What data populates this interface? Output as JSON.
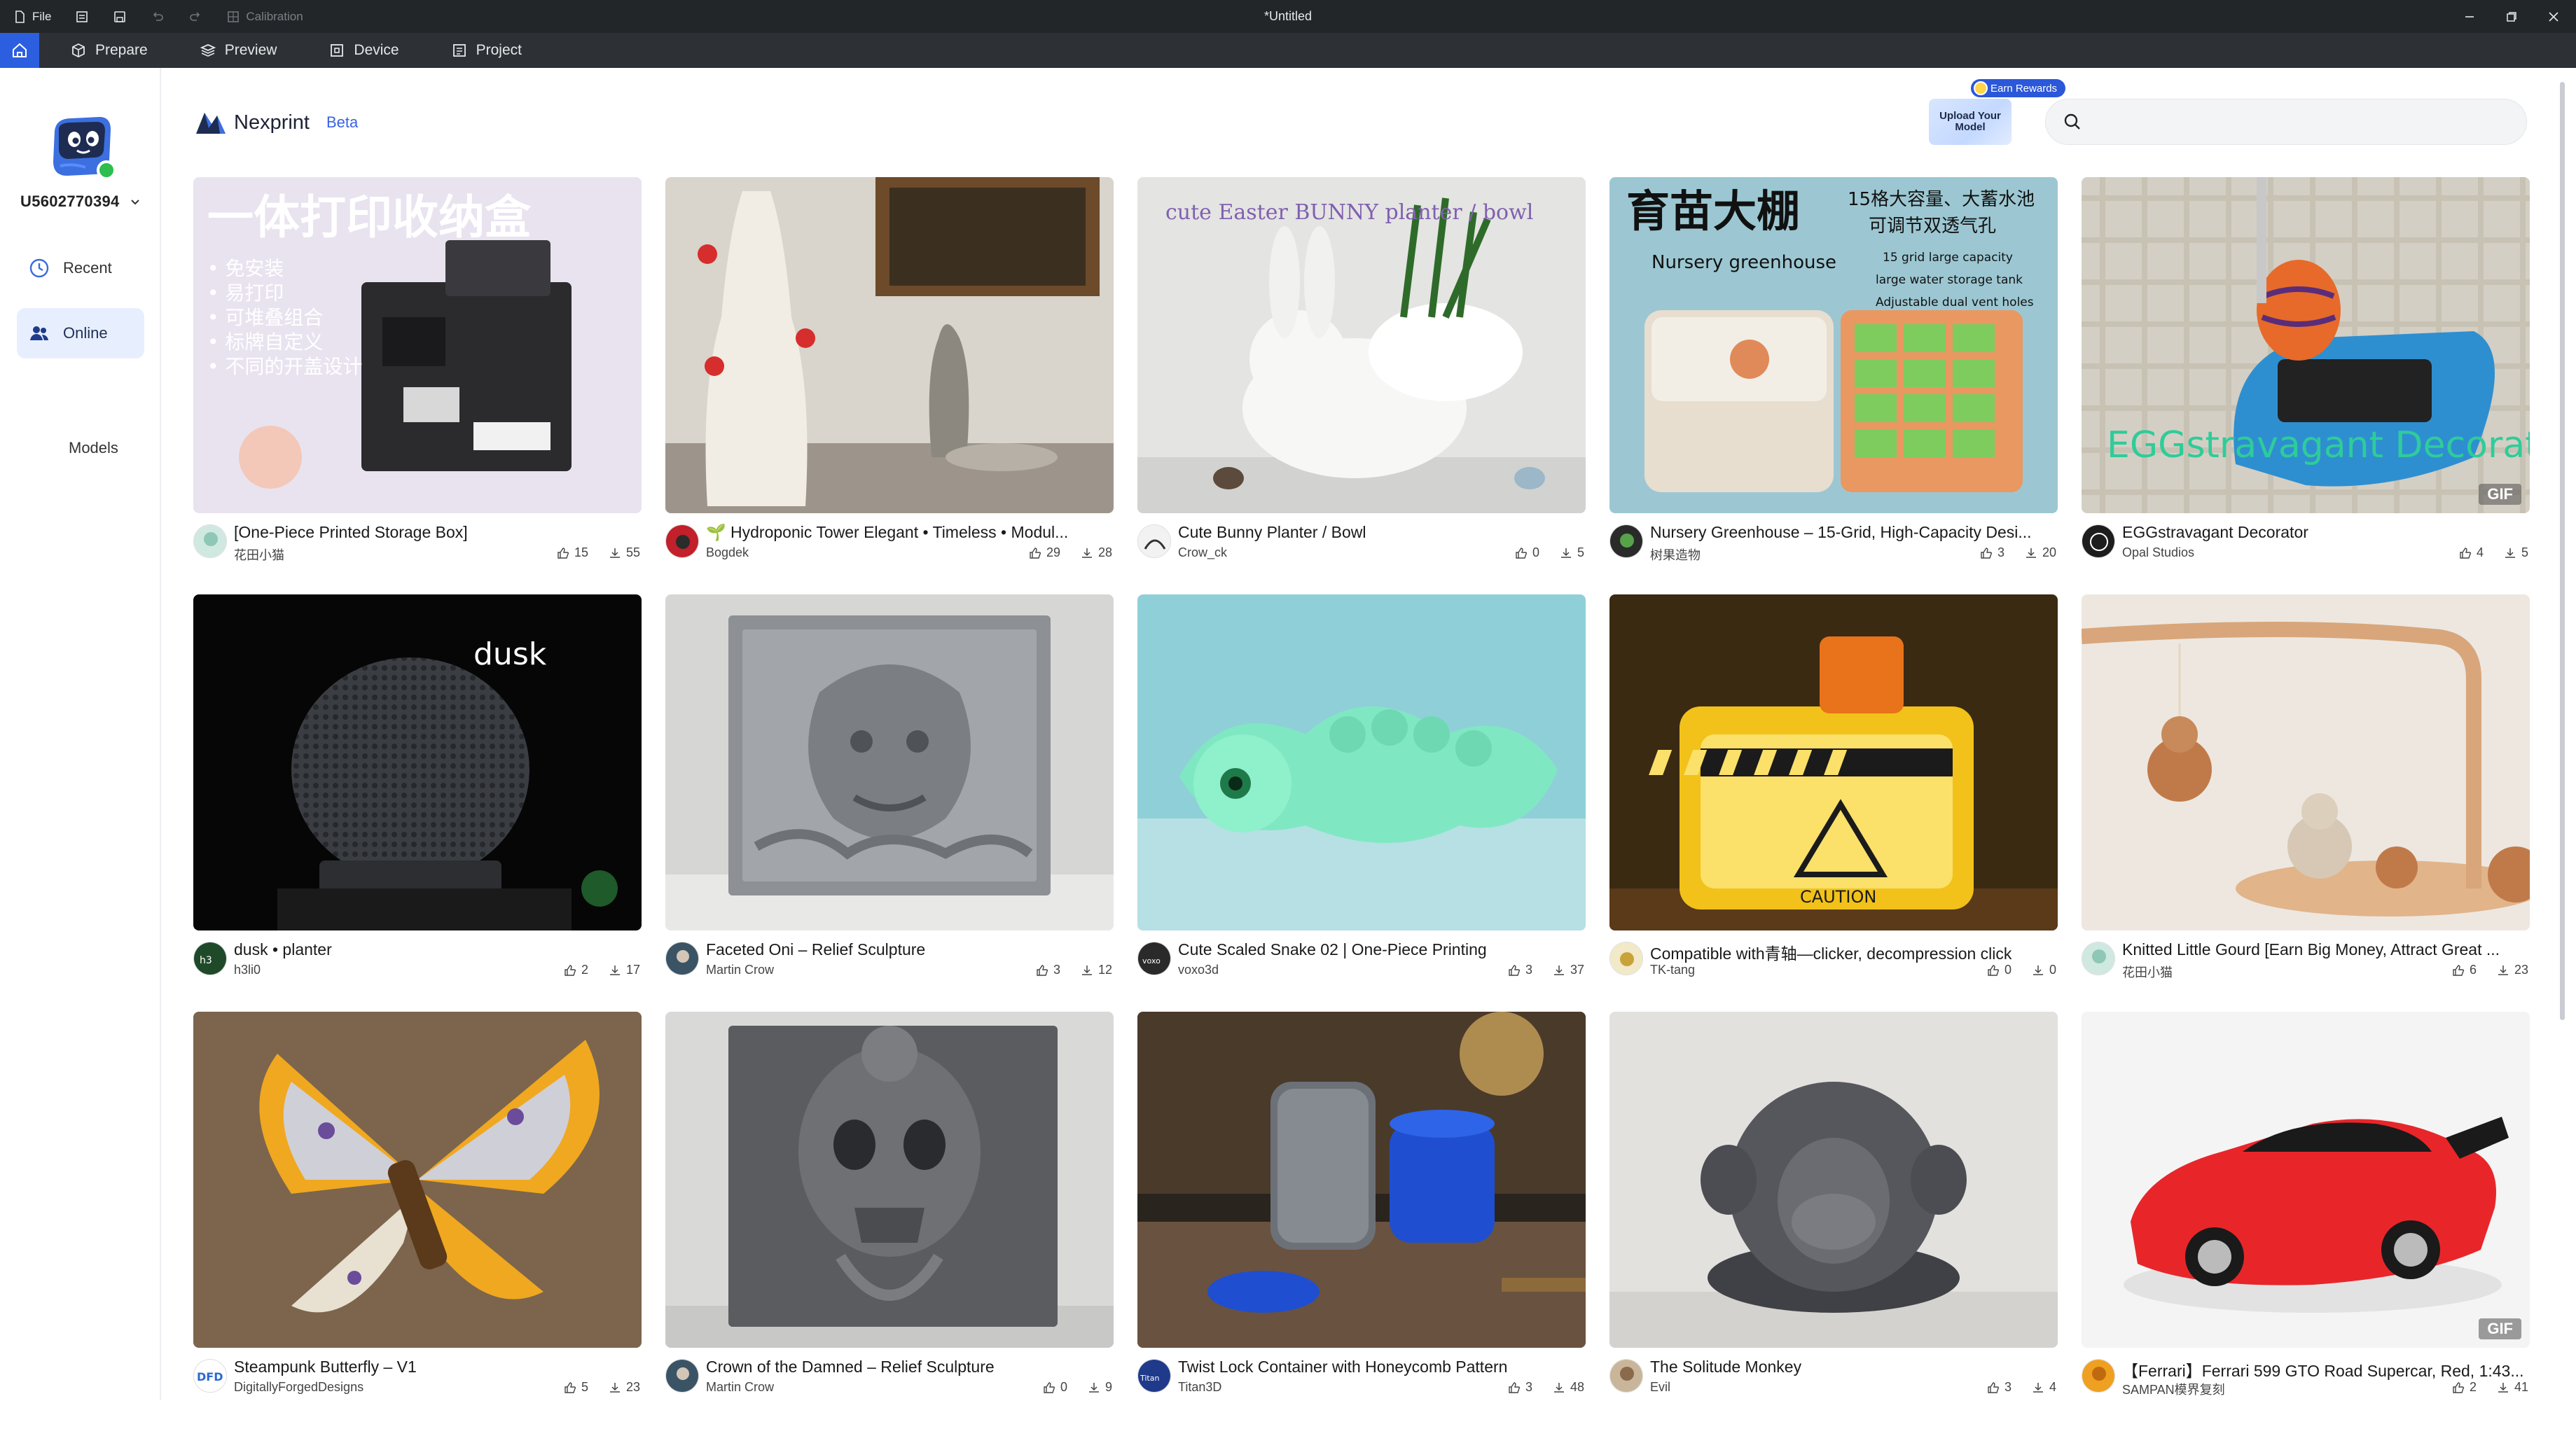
{
  "titlebar": {
    "file_label": "File",
    "calibration_label": "Calibration",
    "window_title": "*Untitled"
  },
  "tabs": [
    {
      "label": "Prepare"
    },
    {
      "label": "Preview"
    },
    {
      "label": "Device"
    },
    {
      "label": "Project"
    }
  ],
  "sidebar": {
    "username": "U5602770394",
    "nav": [
      {
        "label": "Recent"
      },
      {
        "label": "Online"
      }
    ],
    "models_label": "Models"
  },
  "header": {
    "brand_name": "Nexprint",
    "beta_label": "Beta",
    "earn_rewards": "Earn Rewards",
    "upload_label": "Upload Your Model",
    "search_placeholder": ""
  },
  "colors": {
    "accent": "#2c5fe0",
    "online_dot": "#2ebd4f",
    "active_nav_bg": "#e7efff"
  },
  "models": [
    {
      "title": "[One-Piece Printed Storage Box]",
      "author": "花田小猫",
      "likes": "15",
      "downloads": "55",
      "thumb_text": "一体打印收纳盒"
    },
    {
      "title": "🌱 Hydroponic Tower Elegant • Timeless • Modul...",
      "author": "Bogdek",
      "likes": "29",
      "downloads": "28",
      "thumb_text": ""
    },
    {
      "title": "Cute Bunny Planter / Bowl",
      "author": "Crow_ck",
      "likes": "0",
      "downloads": "5",
      "thumb_text": "cute Easter BUNNY planter / bowl"
    },
    {
      "title": "Nursery Greenhouse – 15-Grid, High-Capacity Desi...",
      "author": "树果造物",
      "likes": "3",
      "downloads": "20",
      "thumb_text": "育苗大棚"
    },
    {
      "title": "EGGstravagant Decorator",
      "author": "Opal Studios",
      "likes": "4",
      "downloads": "5",
      "thumb_text": "EGGstravagant Decorator",
      "gif": "GIF"
    },
    {
      "title": "dusk • planter",
      "author": "h3li0",
      "likes": "2",
      "downloads": "17",
      "thumb_text": "dusk"
    },
    {
      "title": "Faceted Oni – Relief Sculpture",
      "author": "Martin Crow",
      "likes": "3",
      "downloads": "12",
      "thumb_text": ""
    },
    {
      "title": "Cute Scaled Snake 02 | One-Piece Printing",
      "author": "voxo3d",
      "likes": "3",
      "downloads": "37",
      "thumb_text": ""
    },
    {
      "title": "Compatible with青轴—clicker, decompression click",
      "author": "TK-tang",
      "likes": "0",
      "downloads": "0",
      "thumb_text": "CAUTION"
    },
    {
      "title": "Knitted Little Gourd [Earn Big Money, Attract Great ...",
      "author": "花田小猫",
      "likes": "6",
      "downloads": "23",
      "thumb_text": ""
    },
    {
      "title": "Steampunk Butterfly – V1",
      "author": "DigitallyForgedDesigns",
      "likes": "5",
      "downloads": "23",
      "thumb_text": ""
    },
    {
      "title": "Crown of the Damned – Relief Sculpture",
      "author": "Martin Crow",
      "likes": "0",
      "downloads": "9",
      "thumb_text": ""
    },
    {
      "title": "Twist Lock Container with Honeycomb Pattern",
      "author": "Titan3D",
      "likes": "3",
      "downloads": "48",
      "thumb_text": ""
    },
    {
      "title": "The Solitude Monkey",
      "author": "Evil",
      "likes": "3",
      "downloads": "4",
      "thumb_text": ""
    },
    {
      "title": "【Ferrari】Ferrari 599 GTO Road Supercar, Red, 1:43...",
      "author": "SAMPAN模界复刻",
      "likes": "2",
      "downloads": "41",
      "thumb_text": "",
      "gif": "GIF"
    }
  ]
}
